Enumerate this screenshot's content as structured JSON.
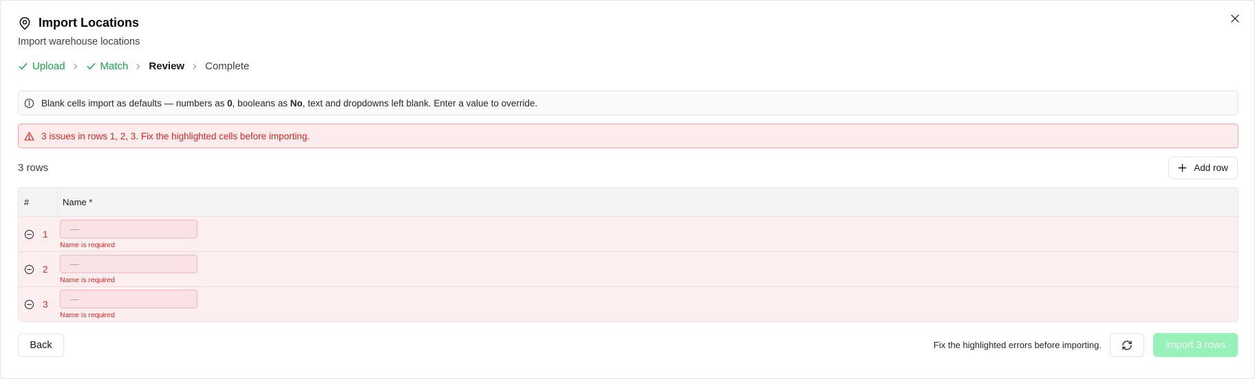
{
  "dialog": {
    "title": "Import Locations",
    "subtitle": "Import warehouse locations",
    "close_icon": "close-icon"
  },
  "steps": [
    {
      "label": "Upload",
      "status": "done"
    },
    {
      "label": "Match",
      "status": "done"
    },
    {
      "label": "Review",
      "status": "active"
    },
    {
      "label": "Complete",
      "status": "pending"
    }
  ],
  "info": {
    "part1": "Blank cells import as defaults — numbers as ",
    "zero": "0",
    "part2": ", booleans as ",
    "no": "No",
    "part3": ", text and dropdowns left blank. Enter a value to override."
  },
  "alert": {
    "text": "3 issues in rows 1, 2, 3. Fix the highlighted cells before importing."
  },
  "table": {
    "rows_count": "3 rows",
    "add_row_label": "Add row",
    "headers": {
      "num": "#",
      "name": "Name *"
    },
    "rows": [
      {
        "num": "1",
        "placeholder": "—",
        "error": "Name is required"
      },
      {
        "num": "2",
        "placeholder": "—",
        "error": "Name is required"
      },
      {
        "num": "3",
        "placeholder": "—",
        "error": "Name is required"
      }
    ]
  },
  "footer": {
    "back_label": "Back",
    "note": "Fix the highlighted errors before importing.",
    "import_label": "Import 3 rows"
  },
  "colors": {
    "success": "#16a34a",
    "error": "#dc2626",
    "import_disabled": "#86efac"
  }
}
